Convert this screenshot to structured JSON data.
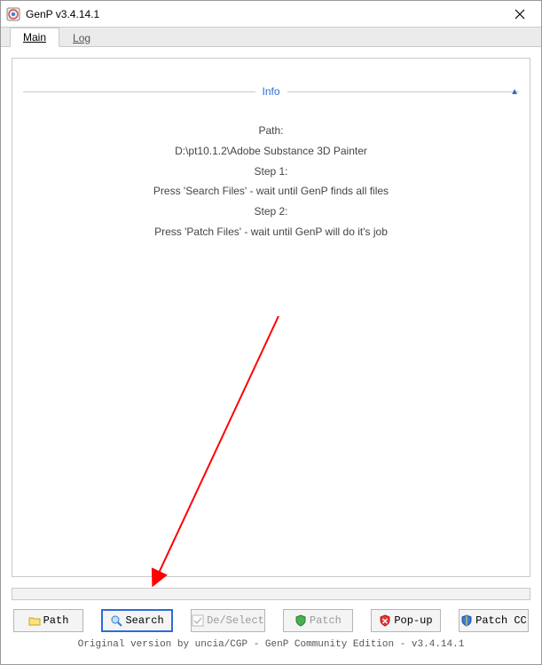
{
  "window": {
    "title": "GenP v3.4.14.1"
  },
  "tabs": {
    "main": "Main",
    "log": "Log"
  },
  "info": {
    "header": "Info",
    "path_label": "Path:",
    "path_value": "D:\\pt10.1.2\\Adobe Substance 3D Painter",
    "step1_label": "Step 1:",
    "step1_text": "Press 'Search Files' - wait until GenP finds all files",
    "step2_label": "Step 2:",
    "step2_text": "Press 'Patch Files' - wait until GenP will do it's job"
  },
  "buttons": {
    "path": "Path",
    "search": "Search",
    "deselect": "De/Select",
    "patch": "Patch",
    "popup": "Pop-up",
    "patchcc": "Patch CC"
  },
  "footer": "Original version by uncia/CGP - GenP Community Edition - v3.4.14.1"
}
